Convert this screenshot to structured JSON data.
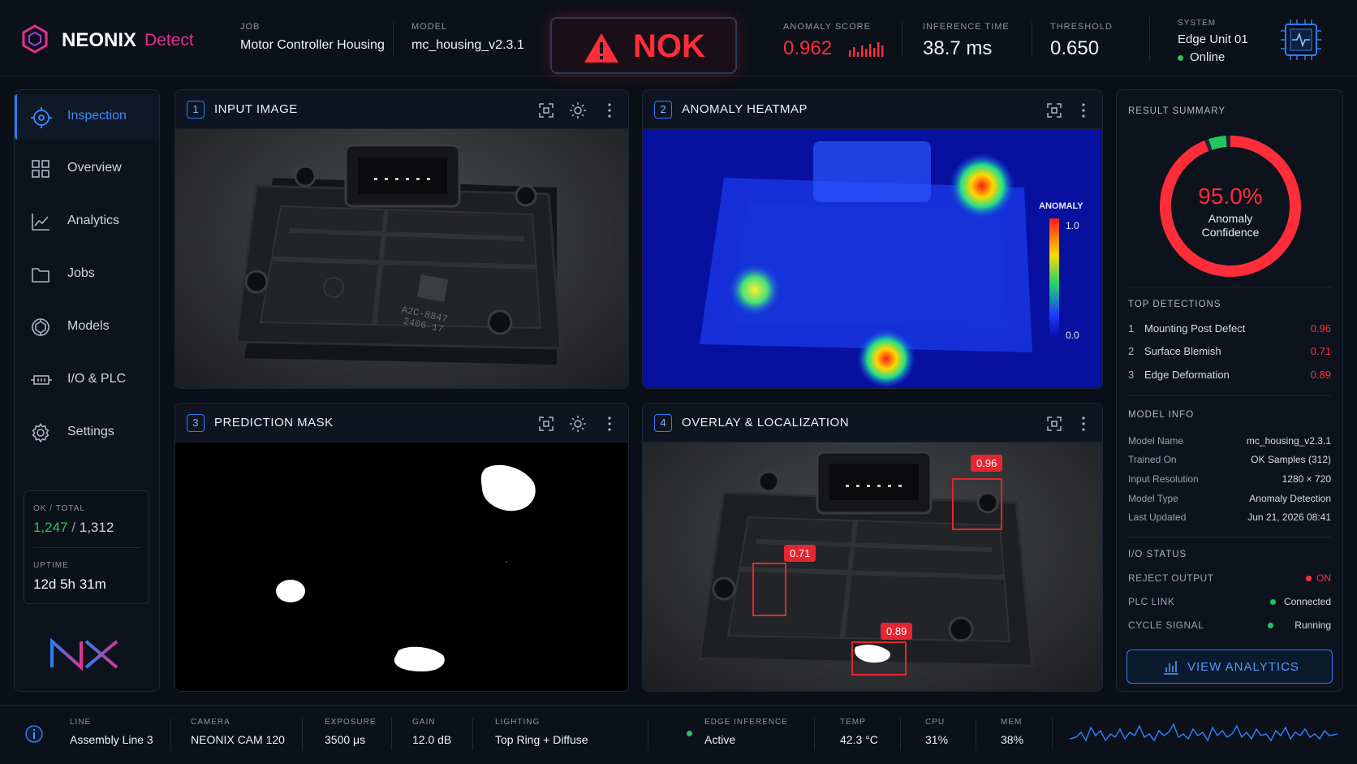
{
  "brand": {
    "name": "NEONIX",
    "product": "Detect"
  },
  "header": {
    "job_label": "JOB",
    "job_value": "Motor Controller Housing",
    "model_label": "MODEL",
    "model_value": "mc_housing_v2.3.1",
    "verdict": "NOK",
    "score_label": "ANOMALY SCORE",
    "score_value": "0.962",
    "inference_label": "INFERENCE TIME",
    "inference_value": "38.7 ms",
    "threshold_label": "THRESHOLD",
    "threshold_value": "0.650",
    "system_label": "SYSTEM",
    "system_unit": "Edge Unit 01",
    "system_status": "Online"
  },
  "sidebar": {
    "items": [
      {
        "label": "Inspection",
        "icon": "crosshair-icon"
      },
      {
        "label": "Overview",
        "icon": "grid-icon"
      },
      {
        "label": "Analytics",
        "icon": "chart-icon"
      },
      {
        "label": "Jobs",
        "icon": "folder-icon"
      },
      {
        "label": "Models",
        "icon": "model-icon"
      },
      {
        "label": "I/O & PLC",
        "icon": "io-icon"
      },
      {
        "label": "Settings",
        "icon": "gear-icon"
      }
    ],
    "ok_total_label": "OK / TOTAL",
    "ok_count": "1,247",
    "total_count": "1,312",
    "uptime_label": "UPTIME",
    "uptime_value": "12d 5h 31m",
    "logo": "NX"
  },
  "panels": {
    "p1": {
      "num": "1",
      "title": "INPUT IMAGE",
      "part_code": "A2C-8847",
      "part_date": "2406-17"
    },
    "p2": {
      "num": "2",
      "title": "ANOMALY HEATMAP",
      "scale_label": "ANOMALY",
      "scale_max": "1.0",
      "scale_min": "0.0"
    },
    "p3": {
      "num": "3",
      "title": "PREDICTION MASK"
    },
    "p4": {
      "num": "4",
      "title": "OVERLAY & LOCALIZATION",
      "tags": [
        "0.96",
        "0.71",
        "0.89"
      ]
    }
  },
  "summary": {
    "title": "RESULT SUMMARY",
    "confidence": "95.0%",
    "confidence_fraction": 0.95,
    "confidence_label1": "Anomaly",
    "confidence_label2": "Confidence",
    "detections_title": "TOP DETECTIONS",
    "detections": [
      {
        "rank": "1",
        "name": "Mounting Post Defect",
        "score": "0.96"
      },
      {
        "rank": "2",
        "name": "Surface Blemish",
        "score": "0.71"
      },
      {
        "rank": "3",
        "name": "Edge Deformation",
        "score": "0.89"
      }
    ],
    "model_title": "MODEL INFO",
    "model_rows": [
      {
        "k": "Model Name",
        "v": "mc_housing_v2.3.1"
      },
      {
        "k": "Trained On",
        "v": "OK Samples (312)"
      },
      {
        "k": "Input Resolution",
        "v": "1280 × 720"
      },
      {
        "k": "Model Type",
        "v": "Anomaly Detection"
      },
      {
        "k": "Last Updated",
        "v": "Jun 21, 2026 08:41"
      }
    ],
    "io_title": "I/O STATUS",
    "io_rows": [
      {
        "k": "REJECT OUTPUT",
        "v": "ON"
      },
      {
        "k": "PLC LINK",
        "v": "Connected"
      },
      {
        "k": "CYCLE SIGNAL",
        "v": "Running"
      }
    ],
    "button": "VIEW ANALYTICS"
  },
  "footer": {
    "line_label": "LINE",
    "line_value": "Assembly Line 3",
    "camera_label": "CAMERA",
    "camera_value": "NEONIX CAM 120",
    "exposure_label": "EXPOSURE",
    "exposure_value": "3500 μs",
    "gain_label": "GAIN",
    "gain_value": "12.0 dB",
    "lighting_label": "LIGHTING",
    "lighting_value": "Top Ring + Diffuse",
    "edge_label": "EDGE INFERENCE",
    "edge_value": "Active",
    "temp_label": "TEMP",
    "temp_value": "42.3 °C",
    "cpu_label": "CPU",
    "cpu_value": "31%",
    "mem_label": "MEM",
    "mem_value": "38%"
  },
  "colors": {
    "accent": "#2e7df6",
    "nok": "#ff2d3a",
    "ok": "#22c55e",
    "magenta": "#e0338f"
  }
}
